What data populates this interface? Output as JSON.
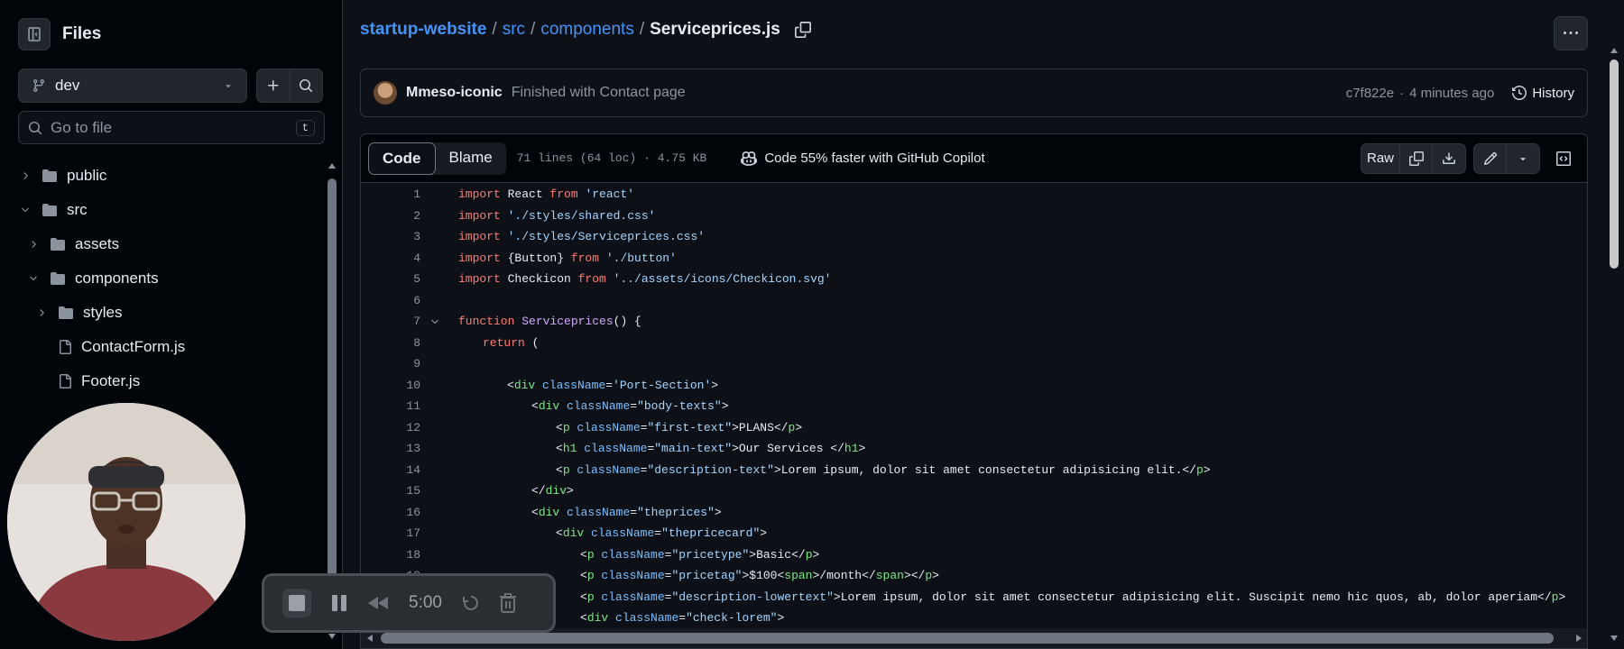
{
  "sidebar": {
    "title": "Files",
    "branch": "dev",
    "goto_placeholder": "Go to file",
    "goto_shortcut": "t",
    "tree": [
      {
        "label": "public",
        "type": "folder",
        "expanded": false,
        "depth": 0
      },
      {
        "label": "src",
        "type": "folder",
        "expanded": true,
        "depth": 0
      },
      {
        "label": "assets",
        "type": "folder",
        "expanded": false,
        "depth": 1
      },
      {
        "label": "components",
        "type": "folder",
        "expanded": true,
        "depth": 1
      },
      {
        "label": "styles",
        "type": "folder",
        "expanded": false,
        "depth": 2
      },
      {
        "label": "ContactForm.js",
        "type": "file",
        "depth": 2
      },
      {
        "label": "Footer.js",
        "type": "file",
        "depth": 2
      }
    ]
  },
  "breadcrumb": {
    "repo": "startup-website",
    "dir1": "src",
    "dir2": "components",
    "file": "Serviceprices.js",
    "sep": "/"
  },
  "commit": {
    "author": "Mmeso-iconic",
    "message": "Finished with Contact page",
    "hash": "c7f822e",
    "dot": "·",
    "time": "4 minutes ago",
    "history_label": "History"
  },
  "viewer": {
    "tab_code": "Code",
    "tab_blame": "Blame",
    "meta": "71 lines (64 loc) · 4.75 KB",
    "copilot": "Code 55% faster with GitHub Copilot",
    "raw_label": "Raw"
  },
  "code_lines": [
    {
      "n": "1",
      "fold": false,
      "indent": 0,
      "parts": [
        [
          "kw",
          "import "
        ],
        [
          "plain",
          "React "
        ],
        [
          "kw",
          "from "
        ],
        [
          "str",
          "'react'"
        ]
      ]
    },
    {
      "n": "2",
      "fold": false,
      "indent": 0,
      "parts": [
        [
          "kw",
          "import "
        ],
        [
          "str",
          "'./styles/shared.css'"
        ]
      ]
    },
    {
      "n": "3",
      "fold": false,
      "indent": 0,
      "parts": [
        [
          "kw",
          "import "
        ],
        [
          "str",
          "'./styles/Serviceprices.css'"
        ]
      ]
    },
    {
      "n": "4",
      "fold": false,
      "indent": 0,
      "parts": [
        [
          "kw",
          "import "
        ],
        [
          "plain",
          "{Button} "
        ],
        [
          "kw",
          "from "
        ],
        [
          "str",
          "'./button'"
        ]
      ]
    },
    {
      "n": "5",
      "fold": false,
      "indent": 0,
      "parts": [
        [
          "kw",
          "import "
        ],
        [
          "plain",
          "Checkicon "
        ],
        [
          "kw",
          "from "
        ],
        [
          "str",
          "'../assets/icons/Checkicon.svg'"
        ]
      ]
    },
    {
      "n": "6",
      "fold": false,
      "indent": 0,
      "parts": []
    },
    {
      "n": "7",
      "fold": true,
      "indent": 0,
      "parts": [
        [
          "kw",
          "function "
        ],
        [
          "fn",
          "Serviceprices"
        ],
        [
          "plain",
          "() {"
        ]
      ]
    },
    {
      "n": "8",
      "fold": false,
      "indent": 1,
      "parts": [
        [
          "kw",
          "return "
        ],
        [
          "plain",
          "("
        ]
      ]
    },
    {
      "n": "9",
      "fold": false,
      "indent": 0,
      "parts": []
    },
    {
      "n": "10",
      "fold": false,
      "indent": 2,
      "parts": [
        [
          "plain",
          "<"
        ],
        [
          "tag",
          "div "
        ],
        [
          "attr",
          "className"
        ],
        [
          "plain",
          "="
        ],
        [
          "str",
          "'Port-Section'"
        ],
        [
          "plain",
          ">"
        ]
      ]
    },
    {
      "n": "11",
      "fold": false,
      "indent": 3,
      "parts": [
        [
          "plain",
          "<"
        ],
        [
          "tag",
          "div "
        ],
        [
          "attr",
          "className"
        ],
        [
          "plain",
          "="
        ],
        [
          "str",
          "\"body-texts\""
        ],
        [
          "plain",
          ">"
        ]
      ]
    },
    {
      "n": "12",
      "fold": false,
      "indent": 4,
      "parts": [
        [
          "plain",
          "<"
        ],
        [
          "tag",
          "p "
        ],
        [
          "attr",
          "className"
        ],
        [
          "plain",
          "="
        ],
        [
          "str",
          "\"first-text\""
        ],
        [
          "plain",
          ">PLANS</"
        ],
        [
          "tag",
          "p"
        ],
        [
          "plain",
          ">"
        ]
      ]
    },
    {
      "n": "13",
      "fold": false,
      "indent": 4,
      "parts": [
        [
          "plain",
          "<"
        ],
        [
          "tag",
          "h1 "
        ],
        [
          "attr",
          "className"
        ],
        [
          "plain",
          "="
        ],
        [
          "str",
          "\"main-text\""
        ],
        [
          "plain",
          ">Our Services </"
        ],
        [
          "tag",
          "h1"
        ],
        [
          "plain",
          ">"
        ]
      ]
    },
    {
      "n": "14",
      "fold": false,
      "indent": 4,
      "parts": [
        [
          "plain",
          "<"
        ],
        [
          "tag",
          "p "
        ],
        [
          "attr",
          "className"
        ],
        [
          "plain",
          "="
        ],
        [
          "str",
          "\"description-text\""
        ],
        [
          "plain",
          ">Lorem ipsum, dolor sit amet consectetur adipisicing elit.</"
        ],
        [
          "tag",
          "p"
        ],
        [
          "plain",
          ">"
        ]
      ]
    },
    {
      "n": "15",
      "fold": false,
      "indent": 3,
      "parts": [
        [
          "plain",
          "</"
        ],
        [
          "tag",
          "div"
        ],
        [
          "plain",
          ">"
        ]
      ]
    },
    {
      "n": "16",
      "fold": false,
      "indent": 3,
      "parts": [
        [
          "plain",
          "<"
        ],
        [
          "tag",
          "div "
        ],
        [
          "attr",
          "className"
        ],
        [
          "plain",
          "="
        ],
        [
          "str",
          "\"theprices\""
        ],
        [
          "plain",
          ">"
        ]
      ]
    },
    {
      "n": "17",
      "fold": false,
      "indent": 4,
      "parts": [
        [
          "plain",
          "<"
        ],
        [
          "tag",
          "div "
        ],
        [
          "attr",
          "className"
        ],
        [
          "plain",
          "="
        ],
        [
          "str",
          "\"thepricecard\""
        ],
        [
          "plain",
          ">"
        ]
      ]
    },
    {
      "n": "18",
      "fold": false,
      "indent": 5,
      "parts": [
        [
          "plain",
          "<"
        ],
        [
          "tag",
          "p "
        ],
        [
          "attr",
          "className"
        ],
        [
          "plain",
          "="
        ],
        [
          "str",
          "\"pricetype\""
        ],
        [
          "plain",
          ">Basic</"
        ],
        [
          "tag",
          "p"
        ],
        [
          "plain",
          ">"
        ]
      ]
    },
    {
      "n": "19",
      "fold": false,
      "indent": 5,
      "parts": [
        [
          "plain",
          "<"
        ],
        [
          "tag",
          "p "
        ],
        [
          "attr",
          "className"
        ],
        [
          "plain",
          "="
        ],
        [
          "str",
          "\"pricetag\""
        ],
        [
          "plain",
          ">$100<"
        ],
        [
          "tag",
          "span"
        ],
        [
          "plain",
          ">/month</"
        ],
        [
          "tag",
          "span"
        ],
        [
          "plain",
          "></"
        ],
        [
          "tag",
          "p"
        ],
        [
          "plain",
          ">"
        ]
      ]
    },
    {
      "n": "20",
      "fold": false,
      "indent": 5,
      "parts": [
        [
          "plain",
          "<"
        ],
        [
          "tag",
          "p "
        ],
        [
          "attr",
          "className"
        ],
        [
          "plain",
          "="
        ],
        [
          "str",
          "\"description-lowertext\""
        ],
        [
          "plain",
          ">Lorem ipsum, dolor sit amet consectetur adipisicing elit. Suscipit nemo hic quos, ab, dolor aperiam</"
        ],
        [
          "tag",
          "p"
        ],
        [
          "plain",
          ">"
        ]
      ]
    },
    {
      "n": "21",
      "fold": false,
      "indent": 5,
      "parts": [
        [
          "plain",
          "<"
        ],
        [
          "tag",
          "div "
        ],
        [
          "attr",
          "className"
        ],
        [
          "plain",
          "="
        ],
        [
          "str",
          "\"check-lorem\""
        ],
        [
          "plain",
          ">"
        ]
      ]
    }
  ],
  "recorder": {
    "time": "5:00"
  },
  "icons": {
    "sidebar_toggle": "sidebar-collapse-icon",
    "branch": "git-branch-icon",
    "add": "plus-icon",
    "search": "search-icon",
    "folder": "folder-icon",
    "file": "file-icon",
    "copy": "copy-icon",
    "history": "history-icon",
    "copilot": "copilot-icon",
    "download": "download-icon",
    "edit": "pencil-icon",
    "symbols": "code-square-icon",
    "kebab": "kebab-horizontal-icon"
  },
  "colors": {
    "link": "#4493f8",
    "keyword": "#ff7b72",
    "string": "#a5d6ff",
    "function": "#d2a8ff",
    "tag": "#7ee787",
    "attr": "#79c0ff"
  }
}
